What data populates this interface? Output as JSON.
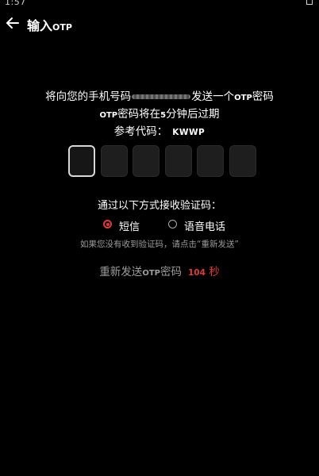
{
  "status_bar": {
    "time": "1:57"
  },
  "header": {
    "title_prefix": "输入",
    "title_suffix": "OTP"
  },
  "info": {
    "line1_prefix": "将向您的手机号码",
    "line1_suffix": "发送一个",
    "line1_otp": "OTP",
    "line1_end": "密码",
    "line2_otp": "OTP",
    "line2_a": "密码将在",
    "line2_minutes": "5",
    "line2_b": "分钟后过期",
    "ref_label": "参考代码：",
    "ref_code": "KWWP"
  },
  "otp": {
    "length": 6,
    "active_index": 0
  },
  "method": {
    "title": "通过以下方式接收验证码：",
    "options": [
      {
        "label": "短信",
        "selected": true
      },
      {
        "label": "语音电话",
        "selected": false
      }
    ]
  },
  "hint": "如果您没有收到验证码，请点击“重新发送”",
  "resend": {
    "prefix": "重新发送",
    "otp": "OTP",
    "suffix": "密码",
    "seconds": "104",
    "seconds_unit": "秒"
  },
  "colors": {
    "accent_red": "#e3373c",
    "background": "#000000",
    "otp_box": "#1e1e1e"
  }
}
